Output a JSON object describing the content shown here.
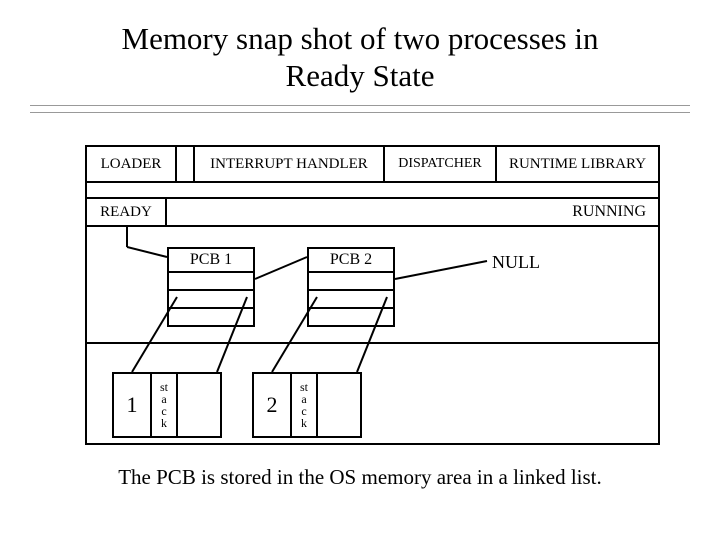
{
  "title": "Memory snap shot of two processes in\nReady State",
  "top_modules": {
    "loader": "LOADER",
    "interrupt_handler": "INTERRUPT HANDLER",
    "dispatcher": "DISPATCHER",
    "runtime_library": "RUNTIME LIBRARY"
  },
  "queue": {
    "ready_label": "READY",
    "running_label": "RUNNING",
    "null_label": "NULL"
  },
  "pcbs": [
    {
      "label": "PCB 1"
    },
    {
      "label": "PCB 2"
    }
  ],
  "processes": [
    {
      "id": "1",
      "stack_label": "st\na\nc\nk"
    },
    {
      "id": "2",
      "stack_label": "st\na\nc\nk"
    }
  ],
  "caption": "The PCB is stored in the OS memory area in a linked list."
}
